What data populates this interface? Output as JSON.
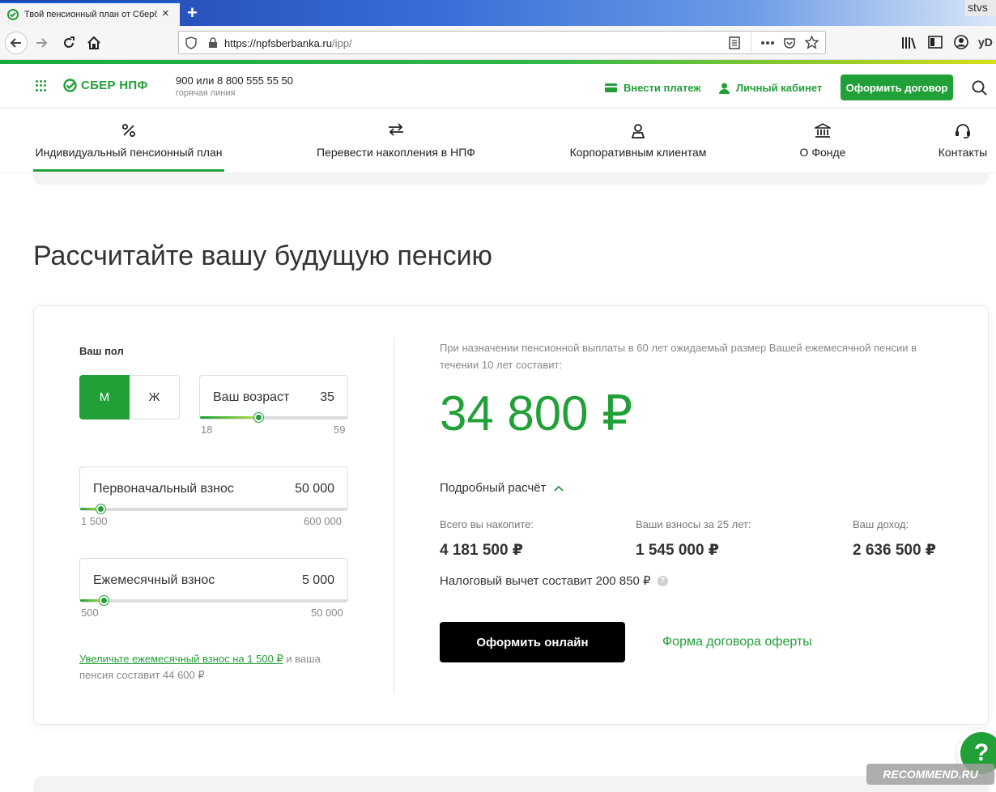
{
  "browser": {
    "tab_title": "Твой пенсионный план от Сбербанка",
    "tab_close": "×",
    "new_tab": "+",
    "url_host": "https://npfsberbanka.ru",
    "url_path": "/ipp/",
    "user_badge": "stvs",
    "yd": "yD"
  },
  "header": {
    "logo_text": "СБЕР НПФ",
    "phone": "900 или 8 800 555 55 50",
    "phone_sub": "горячая линия",
    "pay_label": "Внести платеж",
    "cabinet_label": "Личный кабинет",
    "contract_button": "Оформить договор"
  },
  "menu": [
    {
      "label": "Индивидуальный пенсионный план"
    },
    {
      "label": "Перевести накопления в НПФ"
    },
    {
      "label": "Корпоративным клиентам"
    },
    {
      "label": "О Фонде"
    },
    {
      "label": "Контакты"
    }
  ],
  "page_title": "Рассчитайте вашу будущую пенсию",
  "calculator": {
    "gender_label": "Ваш пол",
    "gender_male": "М",
    "gender_female": "Ж",
    "age": {
      "label": "Ваш возраст",
      "value": "35",
      "min": "18",
      "max": "59",
      "level": 0.4
    },
    "initial": {
      "label": "Первоначальный взнос",
      "value": "50 000",
      "min": "1 500",
      "max": "600 000",
      "level": 0.08
    },
    "monthly": {
      "label": "Ежемесячный взнос",
      "value": "5 000",
      "min": "500",
      "max": "50 000",
      "level": 0.09
    },
    "hint_link": "Увеличьте ежемесячный взнос на 1 500 ₽",
    "hint_rest": " и ваша пенсия составит 44 600 ₽"
  },
  "result": {
    "description": "При назначении пенсионной выплаты в 60 лет ожидаемый размер Вашей ежемесячной пенсии в течении 10 лет составит:",
    "amount": "34 800 ₽",
    "detail_toggle": "Подробный расчёт",
    "total_label": "Всего вы накопите:",
    "total_value": "4 181 500 ₽",
    "contrib_label": "Ваши взносы за 25 лет:",
    "contrib_value": "1 545 000 ₽",
    "income_label": "Ваш доход:",
    "income_value": "2 636 500 ₽",
    "tax": "Налоговый вычет составит 200 850 ₽",
    "tax_help": "?",
    "apply_button": "Оформить онлайн",
    "offer_link": "Форма договора оферты"
  },
  "help_button": "?",
  "watermark": "RECOMMEND.RU",
  "colors": {
    "brand": "#21a038",
    "button_dark": "#000000"
  }
}
